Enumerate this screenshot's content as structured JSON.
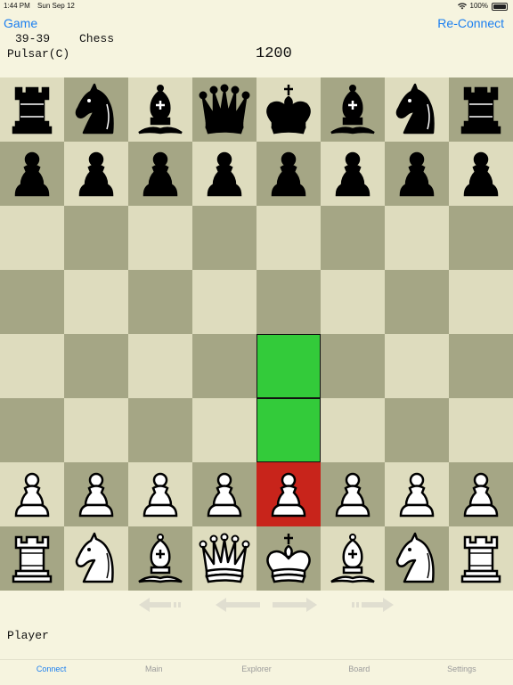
{
  "status_bar": {
    "time": "1:44 PM",
    "date": "Sun Sep 12",
    "battery": "100%"
  },
  "nav": {
    "left_button": "Game",
    "right_button": "Re-Connect"
  },
  "game_info": {
    "score": "39-39",
    "game_type": "Chess",
    "opponent": "Pulsar(C)",
    "rating": "1200"
  },
  "board": {
    "rows": [
      [
        "br",
        "bn",
        "bb",
        "bq",
        "bk",
        "bb",
        "bn",
        "br"
      ],
      [
        "bp",
        "bp",
        "bp",
        "bp",
        "bp",
        "bp",
        "bp",
        "bp"
      ],
      [
        "",
        "",
        "",
        "",
        "",
        "",
        "",
        ""
      ],
      [
        "",
        "",
        "",
        "",
        "",
        "",
        "",
        ""
      ],
      [
        "",
        "",
        "",
        "",
        "",
        "",
        "",
        ""
      ],
      [
        "",
        "",
        "",
        "",
        "",
        "",
        "",
        ""
      ],
      [
        "wp",
        "wp",
        "wp",
        "wp",
        "wp",
        "wp",
        "wp",
        "wp"
      ],
      [
        "wr",
        "wn",
        "wb",
        "wq",
        "wk",
        "wb",
        "wn",
        "wr"
      ]
    ],
    "highlights": {
      "4-4": "green",
      "5-4": "green",
      "6-4": "red"
    },
    "colors": {
      "light": "#dedcbe",
      "dark": "#a5a685",
      "green": "#33cb3a",
      "red": "#c8241b"
    }
  },
  "move_nav": {
    "first": "first-move-arrow-icon",
    "prev": "prev-move-arrow-icon",
    "next": "next-move-arrow-icon",
    "last": "last-move-arrow-icon"
  },
  "player": {
    "name": "Player"
  },
  "tabs": [
    {
      "label": "Connect",
      "active": true
    },
    {
      "label": "Main",
      "active": false
    },
    {
      "label": "Explorer",
      "active": false
    },
    {
      "label": "Board",
      "active": false
    },
    {
      "label": "Settings",
      "active": false
    }
  ]
}
